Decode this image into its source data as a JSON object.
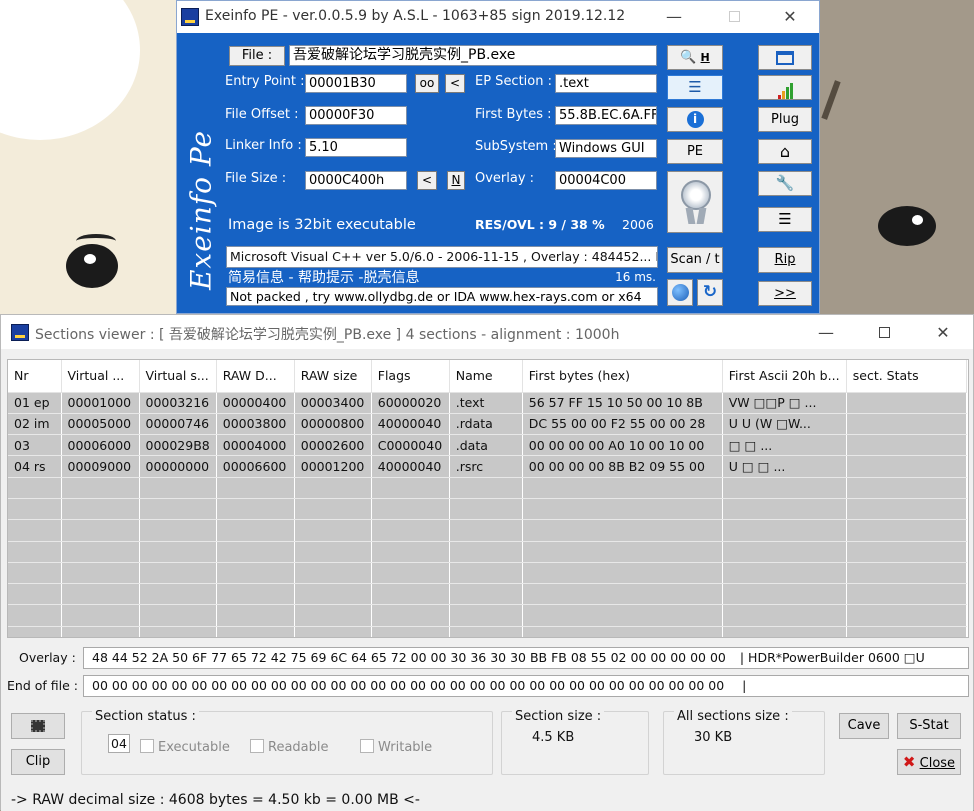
{
  "exeinfo": {
    "title": "Exeinfo PE - ver.0.0.5.9  by A.S.L -  1063+85 sign  2019.12.12",
    "file_btn": "File :",
    "file_name": "吾爱破解论坛学习脱壳实例_PB.exe",
    "entry_point_label": "Entry Point :",
    "entry_point": "00001B30",
    "oo_btn": "oo",
    "lt_btn": "<",
    "ep_section_label": "EP Section :",
    "ep_section": ".text",
    "file_offset_label": "File Offset :",
    "file_offset": "00000F30",
    "first_bytes_label": "First Bytes :",
    "first_bytes": "55.8B.EC.6A.FF",
    "linker_label": "Linker Info :",
    "linker": "5.10",
    "subsystem_label": "SubSystem :",
    "subsystem": "Windows GUI",
    "file_size_label": "File Size :",
    "file_size": "0000C400h",
    "lt_btn2": "<",
    "n_btn": "N",
    "overlay_label": "Overlay :",
    "overlay": "00004C00",
    "image_info": "Image is 32bit executable",
    "res_ovl": "RES/OVL : 9 / 38 %",
    "year": "2006",
    "compiler": "Microsoft Visual C++ ver 5.0/6.0 - 2006-11-15 , Overlay : 484452... N",
    "cn_info": "简易信息 - 帮助提示 -脱壳信息",
    "ms": "16 ms.",
    "not_packed": "Not packed , try  www.ollydbg.de or IDA  www.hex-rays.com  or  x64",
    "h_btn": "H",
    "pe_btn": "PE",
    "scan_btn": "Scan / t",
    "plug_btn": "Plug",
    "rip_btn": "Rip",
    "more_btn": ">>",
    "logo": "Exeinfo Pe"
  },
  "sections_viewer": {
    "title": "Sections viewer :  [ 吾爱破解论坛学习脱壳实例_PB.exe ] 4 sections - alignment : 1000h",
    "columns": [
      "Nr",
      "Virtual ...",
      "Virtual s...",
      "RAW D...",
      "RAW size",
      "Flags",
      "Name",
      "First bytes (hex)",
      "First Ascii 20h b...",
      "sect. Stats"
    ],
    "rows": [
      [
        "01 ep",
        "00001000",
        "00003216",
        "00000400",
        "00003400",
        "60000020",
        ".text",
        "56 57 FF 15 10 50 00 10 8B",
        "VW □□P □   ...",
        ""
      ],
      [
        "02 im",
        "00005000",
        "00000746",
        "00003800",
        "00000800",
        "40000040",
        ".rdata",
        "DC 55 00 00 F2 55 00 00 28",
        "U  U  (W  □W...",
        ""
      ],
      [
        "03",
        "00006000",
        "000029B8",
        "00004000",
        "00002600",
        "C0000040",
        ".data",
        "00 00 00 00 A0 10 00 10 00",
        "     □ □          ...",
        ""
      ],
      [
        "04 rs",
        "00009000",
        "00000000",
        "00006600",
        "00001200",
        "40000040",
        ".rsrc",
        "00 00 00 00 8B B2 09 55 00",
        "     U      □ □  ...",
        ""
      ]
    ],
    "overlay_label": "Overlay :",
    "overlay_hex": "48 44 52 2A 50 6F 77 65 72 42 75 69 6C 64 65 72 00 00 30 36 30 30 BB FB 08 55 02 00 00 00 00 00",
    "overlay_ascii": "|   HDR*PowerBuilder  0600  □U",
    "eof_label": "End of file :",
    "eof_hex": "00 00 00 00 00 00 00 00 00 00 00 00 00 00 00 00 00 00 00 00 00 00 00 00 00 00 00 00 00 00 00 00",
    "eof_ascii": "|",
    "section_status_title": "Section status :",
    "section_number": "04",
    "executable": "Executable",
    "readable": "Readable",
    "writable": "Writable",
    "section_size_title": "Section size :",
    "section_size": "4.5 KB",
    "all_sections_title": "All sections size :",
    "all_sections": "30 KB",
    "clip_btn": "Clip",
    "cave_btn": "Cave",
    "sstat_btn": "S-Stat",
    "close_btn": "Close",
    "status": "->  RAW decimal size :      4608 bytes   =    4.50 kb   = 0.00 MB <-"
  }
}
